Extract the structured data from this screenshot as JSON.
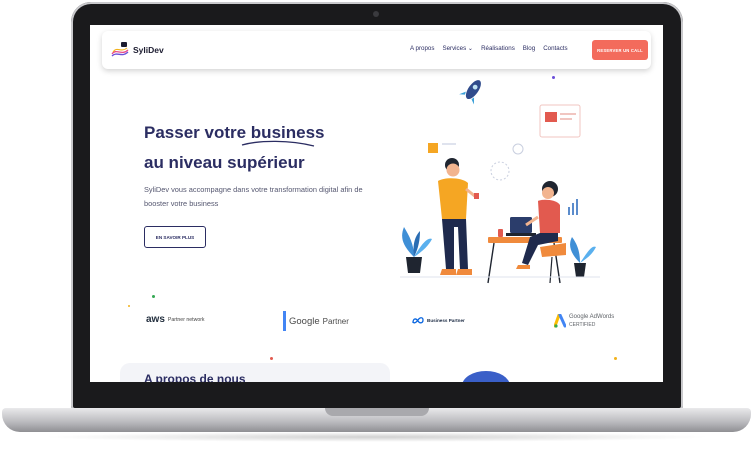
{
  "site": {
    "logo_text": "SyliDev",
    "menu": [
      {
        "label": "A propos"
      },
      {
        "label": "Services"
      },
      {
        "label": "Réalisations"
      },
      {
        "label": "Blog"
      },
      {
        "label": "Contacts"
      }
    ],
    "cta_label": "RESERVER UN CALL"
  },
  "hero": {
    "title_part1": "Passer votre ",
    "title_highlight": "business",
    "title_part2": " au niveau supérieur",
    "description": "SyliDev vous accompagne dans votre transformation digital afin de booster votre business",
    "button_label": "EN SAVOIR PLUS"
  },
  "partners": {
    "aws": {
      "word": "aws",
      "sub": "Partner network"
    },
    "google": {
      "word": "Google",
      "sub": "Partner"
    },
    "meta": {
      "sub": "Business Partner"
    },
    "adwords": {
      "top": "Google AdWords",
      "bottom": "CERTIFIED"
    }
  },
  "about": {
    "title": "A propos de nous"
  },
  "colors": {
    "primary": "#2b2d62",
    "accent": "#f36b5c",
    "text": "#555770"
  }
}
